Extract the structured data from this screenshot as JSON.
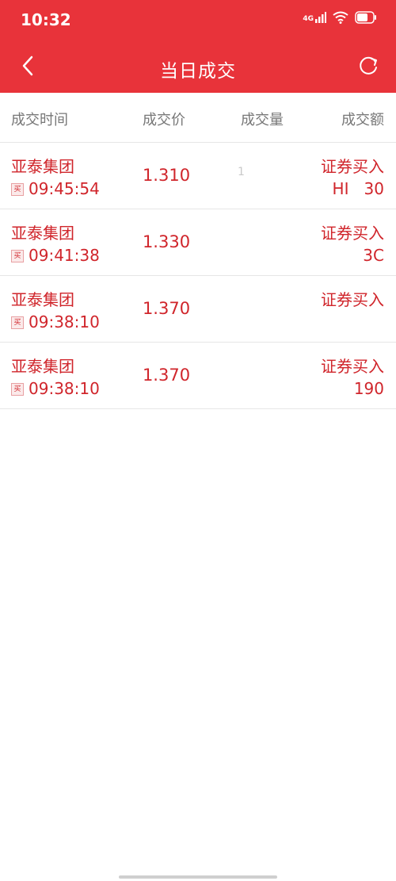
{
  "status_bar": {
    "time": "10:32",
    "network_label": "4G"
  },
  "header": {
    "title": "当日成交",
    "back_icon": "chevron-left-icon",
    "refresh_icon": "refresh-icon",
    "background_color": "#e8333a"
  },
  "columns": [
    "成交时间",
    "成交价",
    "成交量",
    "成交额"
  ],
  "rows": [
    {
      "name": "亚泰集团",
      "side_tag": "买",
      "time": "09:45:54",
      "price": "1.310",
      "quantity": "1",
      "type": "证券买入",
      "amount": "HI   30"
    },
    {
      "name": "亚泰集团",
      "side_tag": "买",
      "time": "09:41:38",
      "price": "1.330",
      "quantity": "",
      "type": "证券买入",
      "amount": "3C"
    },
    {
      "name": "亚泰集团",
      "side_tag": "买",
      "time": "09:38:10",
      "price": "1.370",
      "quantity": "",
      "type": "证券买入",
      "amount": ""
    },
    {
      "name": "亚泰集团",
      "side_tag": "买",
      "time": "09:38:10",
      "price": "1.370",
      "quantity": "",
      "type": "证券买入",
      "amount": "190"
    }
  ],
  "accent_color": "#d0252b"
}
